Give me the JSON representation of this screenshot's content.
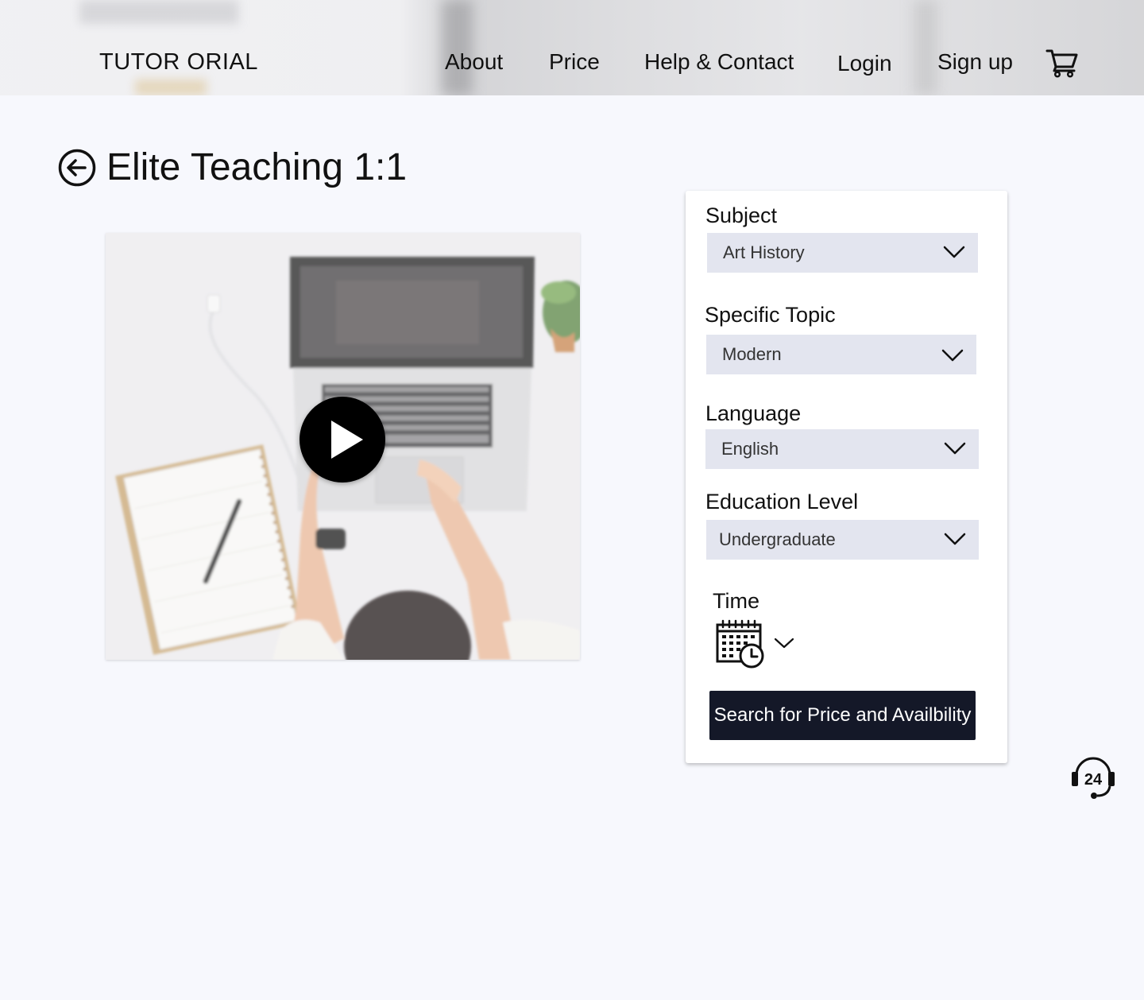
{
  "header": {
    "logo": "TUTOR ORIAL",
    "nav": {
      "about": "About",
      "price": "Price",
      "help": "Help & Contact",
      "login": "Login",
      "signup": "Sign up"
    },
    "cart_icon": "cart-icon"
  },
  "page": {
    "title": "Elite Teaching 1:1",
    "back_icon": "back-arrow-circle-icon"
  },
  "video": {
    "play_icon": "play-icon"
  },
  "form": {
    "subject": {
      "label": "Subject",
      "value": "Art History"
    },
    "topic": {
      "label": "Specific Topic",
      "value": "Modern"
    },
    "language": {
      "label": "Language",
      "value": "English"
    },
    "level": {
      "label": "Education Level",
      "value": "Undergraduate"
    },
    "time": {
      "label": "Time",
      "icon": "calendar-clock-icon"
    },
    "search_button": "Search for Price and Availbility"
  },
  "support": {
    "icon": "support-24-icon",
    "text": "24"
  },
  "colors": {
    "page_bg": "#f7f8fd",
    "select_bg": "#e3e5ef",
    "button_bg": "#141828",
    "button_text": "#ffffff"
  }
}
